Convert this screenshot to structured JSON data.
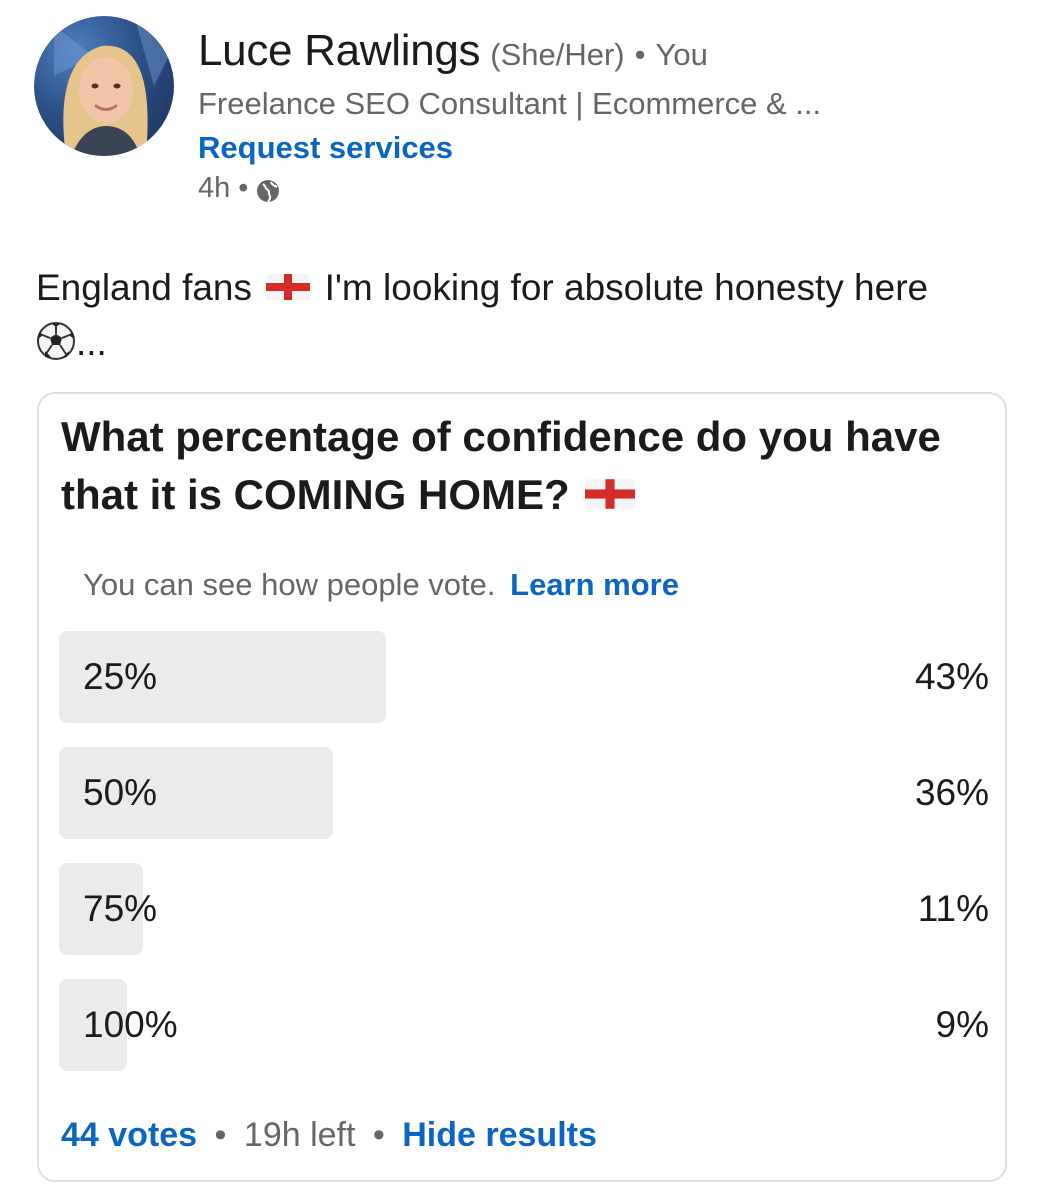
{
  "author": {
    "name": "Luce Rawlings",
    "pronouns": "(She/Her)",
    "relation": "You",
    "headline": "Freelance SEO Consultant | Ecommerce & ...",
    "cta": "Request services",
    "time": "4h",
    "visibility_icon": "globe-icon"
  },
  "post": {
    "text_before_flag": "England fans",
    "text_after_flag": "I'm looking for absolute honesty here",
    "text_after_ball": "...",
    "emojis": [
      "england-flag",
      "soccer-ball"
    ]
  },
  "poll": {
    "question": "What percentage of confidence do you have that it is COMING HOME?",
    "notice": "You can see how people vote.",
    "learn_more": "Learn more",
    "options": [
      {
        "label": "25%",
        "result": "43%",
        "share": 0.43
      },
      {
        "label": "50%",
        "result": "36%",
        "share": 0.36
      },
      {
        "label": "75%",
        "result": "11%",
        "share": 0.11
      },
      {
        "label": "100%",
        "result": "9%",
        "share": 0.09
      }
    ],
    "votes": "44 votes",
    "time_left": "19h left",
    "hide_results": "Hide results"
  },
  "colors": {
    "link": "#0a66c2",
    "muted": "#666666",
    "bar": "#ebebeb",
    "flag_red": "#d62b2b"
  }
}
